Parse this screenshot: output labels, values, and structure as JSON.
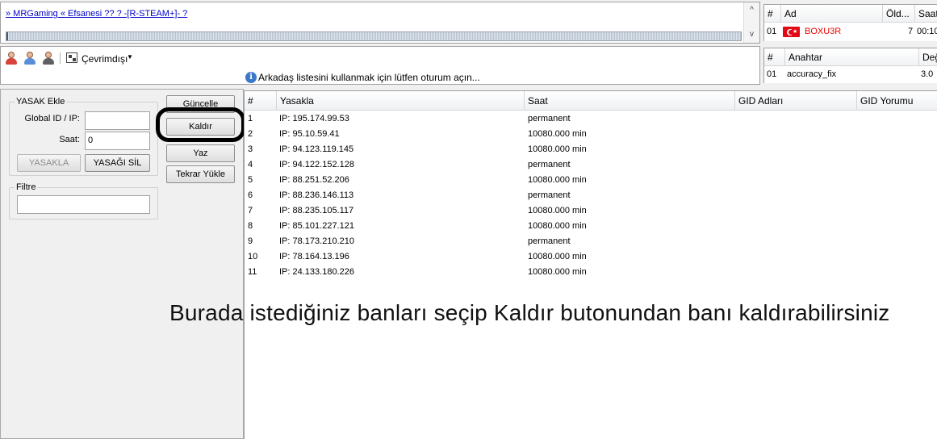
{
  "server": {
    "link_text": "» MRGaming « Efsanesi ?? ? -[R-STEAM+]- ?",
    "scroll_up": "^",
    "scroll_down": "v"
  },
  "players": {
    "headers": [
      "#",
      "Ad",
      "Öld...",
      "Saat"
    ],
    "rows": [
      {
        "num": "01",
        "name": "BOXU3R",
        "kills": "7",
        "time": "00:10",
        "flag": "turkey-flag-icon"
      }
    ]
  },
  "friends": {
    "status_label": "Çevrimdışı",
    "message": "Arkadaş listesini kullanmak için lütfen oturum açın..."
  },
  "cvars": {
    "headers": [
      "#",
      "Anahtar",
      "Değ"
    ],
    "rows": [
      {
        "num": "01",
        "key": "accuracy_fix",
        "value": "3.0"
      }
    ]
  },
  "ban_add": {
    "group_title": "YASAK Ekle",
    "id_label": "Global ID / IP:",
    "id_value": "",
    "time_label": "Saat:",
    "time_value": "0",
    "ban_button": "YASAKLA",
    "unban_button": "YASAĞI SİL"
  },
  "filter": {
    "group_title": "Filtre",
    "value": ""
  },
  "actions": {
    "refresh": "Güncelle",
    "remove": "Kaldır",
    "write": "Yaz",
    "reload": "Tekrar Yükle"
  },
  "banlist": {
    "headers": [
      "#",
      "Yasakla",
      "Saat",
      "GID Adları",
      "GID Yorumu"
    ],
    "rows": [
      {
        "num": "1",
        "target": "IP: 195.174.99.53",
        "time": "permanent"
      },
      {
        "num": "2",
        "target": "IP: 95.10.59.41",
        "time": "10080.000 min"
      },
      {
        "num": "3",
        "target": "IP: 94.123.119.145",
        "time": "10080.000 min"
      },
      {
        "num": "4",
        "target": "IP: 94.122.152.128",
        "time": "permanent"
      },
      {
        "num": "5",
        "target": "IP: 88.251.52.206",
        "time": "10080.000 min"
      },
      {
        "num": "6",
        "target": "IP: 88.236.146.113",
        "time": "permanent"
      },
      {
        "num": "7",
        "target": "IP: 88.235.105.117",
        "time": "10080.000 min"
      },
      {
        "num": "8",
        "target": "IP: 85.101.227.121",
        "time": "10080.000 min"
      },
      {
        "num": "9",
        "target": "IP: 78.173.210.210",
        "time": "permanent"
      },
      {
        "num": "10",
        "target": "IP: 78.164.13.196",
        "time": "10080.000 min"
      },
      {
        "num": "11",
        "target": "IP: 24.133.180.226",
        "time": "10080.000 min"
      }
    ]
  },
  "caption": "Burada istediğiniz banları seçip Kaldır butonundan banı kaldırabilirsiniz",
  "colors": {
    "link": "#0000cc",
    "player_name": "#ee0000",
    "highlight_ring": "#000000"
  }
}
